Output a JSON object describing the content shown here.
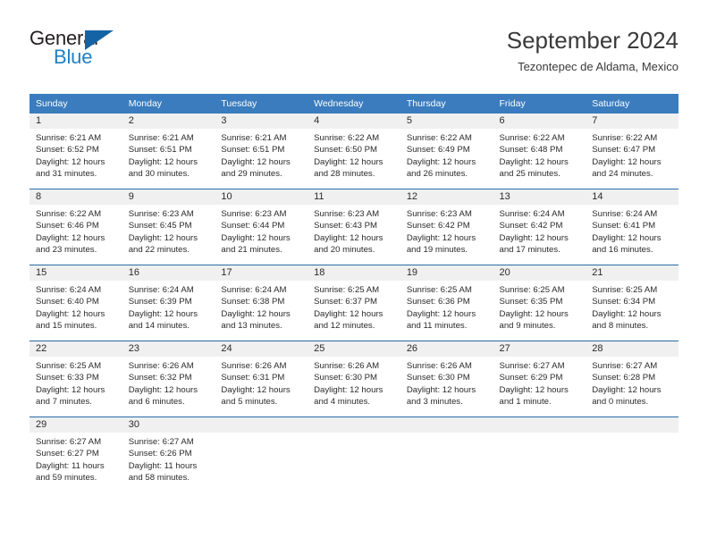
{
  "brand": {
    "name_part1": "General",
    "name_part2": "Blue",
    "triangle_icon": "triangle-icon"
  },
  "header": {
    "title": "September 2024",
    "subtitle": "Tezontepec de Aldama, Mexico"
  },
  "colors": {
    "header_blue": "#3a7cbe",
    "row_border_blue": "#2a6ba8",
    "daynum_band": "#f0f0f0",
    "brand_blue": "#1f7fc4",
    "brand_triangle": "#1464a5",
    "text": "#2b2b2b"
  },
  "weekday_headers": [
    "Sunday",
    "Monday",
    "Tuesday",
    "Wednesday",
    "Thursday",
    "Friday",
    "Saturday"
  ],
  "labels": {
    "sunrise_prefix": "Sunrise:",
    "sunset_prefix": "Sunset:",
    "daylight_prefix": "Daylight:"
  },
  "weeks": [
    [
      {
        "day": "1",
        "sunrise": "Sunrise: 6:21 AM",
        "sunset": "Sunset: 6:52 PM",
        "daylight": "Daylight: 12 hours and 31 minutes."
      },
      {
        "day": "2",
        "sunrise": "Sunrise: 6:21 AM",
        "sunset": "Sunset: 6:51 PM",
        "daylight": "Daylight: 12 hours and 30 minutes."
      },
      {
        "day": "3",
        "sunrise": "Sunrise: 6:21 AM",
        "sunset": "Sunset: 6:51 PM",
        "daylight": "Daylight: 12 hours and 29 minutes."
      },
      {
        "day": "4",
        "sunrise": "Sunrise: 6:22 AM",
        "sunset": "Sunset: 6:50 PM",
        "daylight": "Daylight: 12 hours and 28 minutes."
      },
      {
        "day": "5",
        "sunrise": "Sunrise: 6:22 AM",
        "sunset": "Sunset: 6:49 PM",
        "daylight": "Daylight: 12 hours and 26 minutes."
      },
      {
        "day": "6",
        "sunrise": "Sunrise: 6:22 AM",
        "sunset": "Sunset: 6:48 PM",
        "daylight": "Daylight: 12 hours and 25 minutes."
      },
      {
        "day": "7",
        "sunrise": "Sunrise: 6:22 AM",
        "sunset": "Sunset: 6:47 PM",
        "daylight": "Daylight: 12 hours and 24 minutes."
      }
    ],
    [
      {
        "day": "8",
        "sunrise": "Sunrise: 6:22 AM",
        "sunset": "Sunset: 6:46 PM",
        "daylight": "Daylight: 12 hours and 23 minutes."
      },
      {
        "day": "9",
        "sunrise": "Sunrise: 6:23 AM",
        "sunset": "Sunset: 6:45 PM",
        "daylight": "Daylight: 12 hours and 22 minutes."
      },
      {
        "day": "10",
        "sunrise": "Sunrise: 6:23 AM",
        "sunset": "Sunset: 6:44 PM",
        "daylight": "Daylight: 12 hours and 21 minutes."
      },
      {
        "day": "11",
        "sunrise": "Sunrise: 6:23 AM",
        "sunset": "Sunset: 6:43 PM",
        "daylight": "Daylight: 12 hours and 20 minutes."
      },
      {
        "day": "12",
        "sunrise": "Sunrise: 6:23 AM",
        "sunset": "Sunset: 6:42 PM",
        "daylight": "Daylight: 12 hours and 19 minutes."
      },
      {
        "day": "13",
        "sunrise": "Sunrise: 6:24 AM",
        "sunset": "Sunset: 6:42 PM",
        "daylight": "Daylight: 12 hours and 17 minutes."
      },
      {
        "day": "14",
        "sunrise": "Sunrise: 6:24 AM",
        "sunset": "Sunset: 6:41 PM",
        "daylight": "Daylight: 12 hours and 16 minutes."
      }
    ],
    [
      {
        "day": "15",
        "sunrise": "Sunrise: 6:24 AM",
        "sunset": "Sunset: 6:40 PM",
        "daylight": "Daylight: 12 hours and 15 minutes."
      },
      {
        "day": "16",
        "sunrise": "Sunrise: 6:24 AM",
        "sunset": "Sunset: 6:39 PM",
        "daylight": "Daylight: 12 hours and 14 minutes."
      },
      {
        "day": "17",
        "sunrise": "Sunrise: 6:24 AM",
        "sunset": "Sunset: 6:38 PM",
        "daylight": "Daylight: 12 hours and 13 minutes."
      },
      {
        "day": "18",
        "sunrise": "Sunrise: 6:25 AM",
        "sunset": "Sunset: 6:37 PM",
        "daylight": "Daylight: 12 hours and 12 minutes."
      },
      {
        "day": "19",
        "sunrise": "Sunrise: 6:25 AM",
        "sunset": "Sunset: 6:36 PM",
        "daylight": "Daylight: 12 hours and 11 minutes."
      },
      {
        "day": "20",
        "sunrise": "Sunrise: 6:25 AM",
        "sunset": "Sunset: 6:35 PM",
        "daylight": "Daylight: 12 hours and 9 minutes."
      },
      {
        "day": "21",
        "sunrise": "Sunrise: 6:25 AM",
        "sunset": "Sunset: 6:34 PM",
        "daylight": "Daylight: 12 hours and 8 minutes."
      }
    ],
    [
      {
        "day": "22",
        "sunrise": "Sunrise: 6:25 AM",
        "sunset": "Sunset: 6:33 PM",
        "daylight": "Daylight: 12 hours and 7 minutes."
      },
      {
        "day": "23",
        "sunrise": "Sunrise: 6:26 AM",
        "sunset": "Sunset: 6:32 PM",
        "daylight": "Daylight: 12 hours and 6 minutes."
      },
      {
        "day": "24",
        "sunrise": "Sunrise: 6:26 AM",
        "sunset": "Sunset: 6:31 PM",
        "daylight": "Daylight: 12 hours and 5 minutes."
      },
      {
        "day": "25",
        "sunrise": "Sunrise: 6:26 AM",
        "sunset": "Sunset: 6:30 PM",
        "daylight": "Daylight: 12 hours and 4 minutes."
      },
      {
        "day": "26",
        "sunrise": "Sunrise: 6:26 AM",
        "sunset": "Sunset: 6:30 PM",
        "daylight": "Daylight: 12 hours and 3 minutes."
      },
      {
        "day": "27",
        "sunrise": "Sunrise: 6:27 AM",
        "sunset": "Sunset: 6:29 PM",
        "daylight": "Daylight: 12 hours and 1 minute."
      },
      {
        "day": "28",
        "sunrise": "Sunrise: 6:27 AM",
        "sunset": "Sunset: 6:28 PM",
        "daylight": "Daylight: 12 hours and 0 minutes."
      }
    ],
    [
      {
        "day": "29",
        "sunrise": "Sunrise: 6:27 AM",
        "sunset": "Sunset: 6:27 PM",
        "daylight": "Daylight: 11 hours and 59 minutes."
      },
      {
        "day": "30",
        "sunrise": "Sunrise: 6:27 AM",
        "sunset": "Sunset: 6:26 PM",
        "daylight": "Daylight: 11 hours and 58 minutes."
      },
      {
        "day": "",
        "sunrise": "",
        "sunset": "",
        "daylight": ""
      },
      {
        "day": "",
        "sunrise": "",
        "sunset": "",
        "daylight": ""
      },
      {
        "day": "",
        "sunrise": "",
        "sunset": "",
        "daylight": ""
      },
      {
        "day": "",
        "sunrise": "",
        "sunset": "",
        "daylight": ""
      },
      {
        "day": "",
        "sunrise": "",
        "sunset": "",
        "daylight": ""
      }
    ]
  ]
}
